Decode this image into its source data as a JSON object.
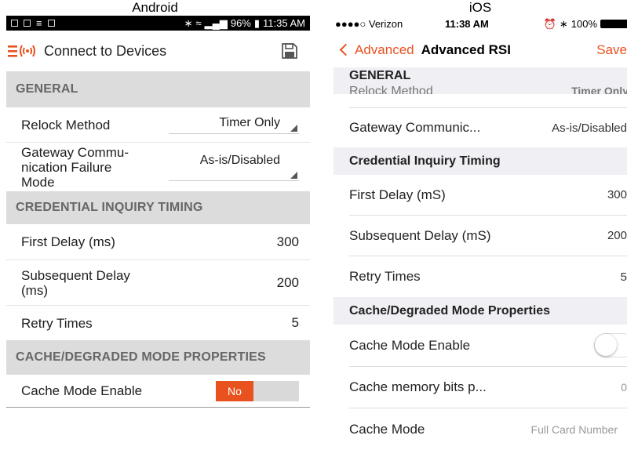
{
  "captions": {
    "android": "Android",
    "ios": "iOS"
  },
  "android": {
    "status": {
      "battery": "96%",
      "time": "11:35 AM"
    },
    "toolbar": {
      "title": "Connect to Devices"
    },
    "sections": [
      {
        "title": "GENERAL",
        "rows": [
          {
            "label": "Relock Method",
            "value": "Timer Only"
          },
          {
            "label": "Gateway Commu-\nnication Failure\nMode",
            "value": "As-is/Disabled"
          }
        ]
      },
      {
        "title": "CREDENTIAL INQUIRY TIMING",
        "rows": [
          {
            "label": "First Delay (ms)",
            "value": "300"
          },
          {
            "label": "Subsequent Delay\n(ms)",
            "value": "200"
          },
          {
            "label": "Retry Times",
            "value": "5"
          }
        ]
      },
      {
        "title": "CACHE/DEGRADED MODE PROPERTIES",
        "rows": [
          {
            "label": "Cache Mode Enable",
            "value": "No"
          }
        ]
      }
    ],
    "accent_color": "#e8521f"
  },
  "ios": {
    "status": {
      "carrier": "●●●●○ Verizon",
      "time": "11:38 AM",
      "battery": "100%"
    },
    "nav": {
      "back_label": "Advanced",
      "title": "Advanced RSI",
      "save_label": "Save"
    },
    "sections": [
      {
        "title": "GENERAL",
        "ghost_label": "Relock Method",
        "ghost_value": "Timer Only",
        "rows": [
          {
            "label": "Gateway Communic...",
            "value": "As-is/Disabled"
          }
        ]
      },
      {
        "title": "Credential Inquiry Timing",
        "rows": [
          {
            "label": "First Delay (mS)",
            "value": "300"
          },
          {
            "label": "Subsequent Delay (mS)",
            "value": "200"
          },
          {
            "label": "Retry Times",
            "value": "5"
          }
        ]
      },
      {
        "title": "Cache/Degraded Mode Properties",
        "rows": [
          {
            "label": "Cache Mode Enable",
            "value": "off"
          },
          {
            "label": "Cache memory bits p...",
            "value": "0"
          },
          {
            "label": "Cache Mode",
            "value": "Full Card Number"
          }
        ]
      }
    ],
    "accent_color": "#e8521f"
  }
}
